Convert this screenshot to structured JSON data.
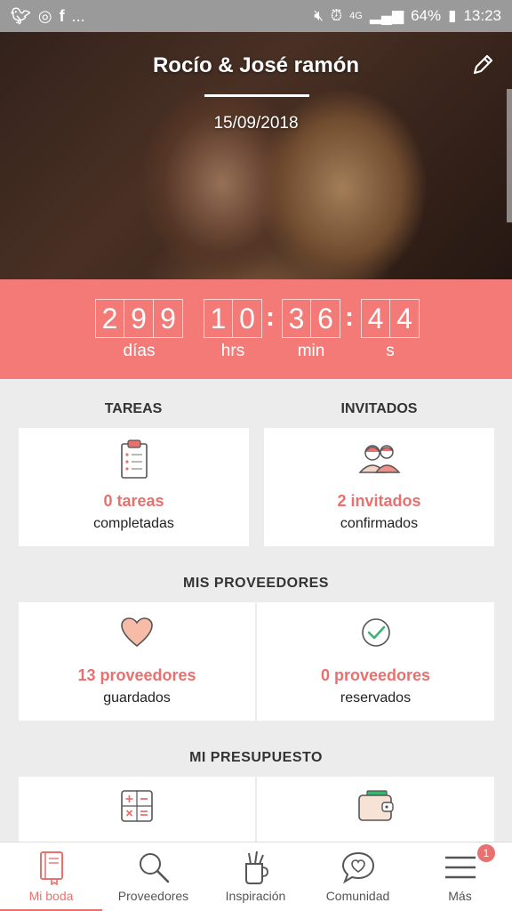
{
  "status_bar": {
    "left_icons": [
      "twitter-icon",
      "instagram-icon",
      "facebook-icon"
    ],
    "more": "...",
    "network": "4G",
    "battery": "64%",
    "time": "13:23"
  },
  "hero": {
    "couple_names": "Rocío & José ramón",
    "wedding_date": "15/09/2018"
  },
  "countdown": {
    "days_digits": [
      "2",
      "9",
      "9"
    ],
    "hours_digits": [
      "1",
      "0"
    ],
    "minutes_digits": [
      "3",
      "6"
    ],
    "seconds_digits": [
      "4",
      "4"
    ],
    "separator": ":",
    "days_label": "días",
    "hours_label": "hrs",
    "minutes_label": "min",
    "seconds_label": "s"
  },
  "tasks": {
    "title": "TAREAS",
    "count": "0 tareas",
    "sub": "completadas"
  },
  "guests": {
    "title": "INVITADOS",
    "count": "2 invitados",
    "sub": "confirmados"
  },
  "vendors": {
    "title": "MIS PROVEEDORES",
    "saved_count": "13 proveedores",
    "saved_sub": "guardados",
    "booked_count": "0 proveedores",
    "booked_sub": "reservados"
  },
  "budget": {
    "title": "MI PRESUPUESTO"
  },
  "nav": {
    "items": [
      {
        "label": "Mi boda",
        "icon": "notebook-icon"
      },
      {
        "label": "Proveedores",
        "icon": "search-icon"
      },
      {
        "label": "Inspiración",
        "icon": "pencil-cup-icon"
      },
      {
        "label": "Comunidad",
        "icon": "chat-heart-icon"
      },
      {
        "label": "Más",
        "icon": "menu-icon"
      }
    ],
    "more_badge": "1"
  },
  "colors": {
    "accent": "#f47a77",
    "accent_text": "#e8716f",
    "background": "#ececec"
  }
}
